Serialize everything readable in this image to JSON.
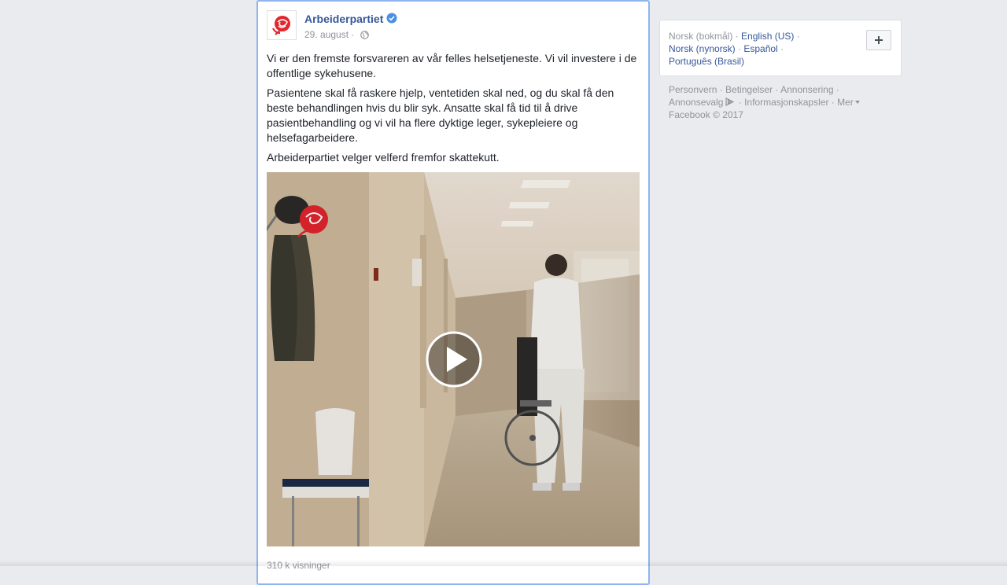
{
  "post": {
    "author": "Arbeiderpartiet",
    "date": "29. august",
    "separator": " · ",
    "paragraphs": [
      "Vi er den fremste forsvareren av vår felles helsetjeneste. Vi vil investere i de offentlige sykehusene.",
      "Pasientene skal få raskere hjelp, ventetiden skal ned, og du skal få den beste behandlingen hvis du blir syk. Ansatte skal få tid til å drive pasientbehandling og vi vil ha flere dyktige leger, sykepleiere og helsefagarbeidere.",
      "Arbeiderpartiet velger velferd fremfor skattekutt."
    ],
    "views": "310 k visninger",
    "icons": {
      "avatar": "rose-logo-icon",
      "verified": "verified-badge-icon",
      "privacy": "globe-icon",
      "play": "play-icon"
    },
    "colors": {
      "link": "#365899",
      "accent_border": "#8fb4f0",
      "verified": "#4a90e2",
      "rose": "#e2252e"
    }
  },
  "languages": {
    "current": "Norsk (bokmål)",
    "english": "English (US)",
    "nynorsk": "Norsk (nynorsk)",
    "spanish": "Español",
    "portuguese": "Português (Brasil)",
    "sep": " · ",
    "add_icon": "plus-icon"
  },
  "footer": {
    "privacy": "Personvern",
    "terms": "Betingelser",
    "advertising": "Annonsering",
    "ad_choices": "Annonsevalg",
    "cookies": "Informasjonskapsler",
    "more": "Mer",
    "copyright": "Facebook © 2017",
    "sep": " · "
  }
}
